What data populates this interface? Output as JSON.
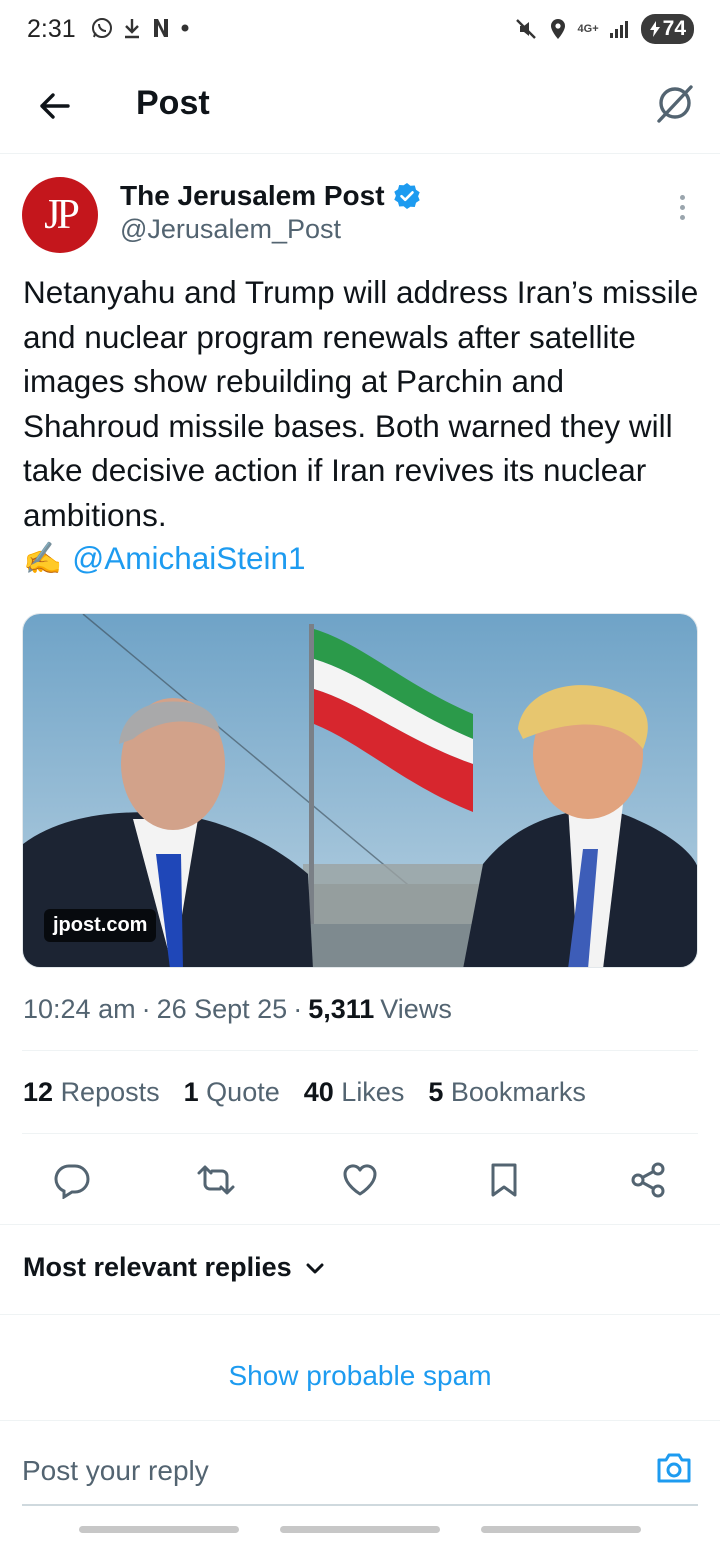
{
  "status_bar": {
    "time": "2:31",
    "left_icons": [
      "whatsapp-icon",
      "download-icon",
      "netflix-icon",
      "dot-icon"
    ],
    "network": "4G+",
    "battery": "74",
    "right_icons": [
      "mute-icon",
      "location-icon",
      "signal-icon",
      "battery-icon"
    ]
  },
  "header": {
    "title": "Post",
    "back_icon": "arrow-left-icon",
    "grok_icon": "grok-icon"
  },
  "author": {
    "avatar_text": "JP",
    "name": "The Jerusalem Post",
    "handle": "@Jerusalem_Post",
    "verified": true,
    "accent": "#1d9bf0",
    "avatar_color": "#c4161c"
  },
  "tweet": {
    "text": "Netanyahu and Trump will address Iran’s missile and nuclear program renewals after satellite images show rebuilding at Parchin and Shahroud missile bases. Both warned they will take decisive action if Iran revives its nuclear ambitions.",
    "mention_emoji": "✍️",
    "mention": "@AmichaiStein1",
    "media_source": "jpost.com"
  },
  "meta": {
    "time": "10:24 am",
    "sep1": "·",
    "date": "26 Sept 25",
    "sep2": "·",
    "views_count": "5,311",
    "views_label": "Views"
  },
  "stats": [
    {
      "count": "12",
      "label": "Reposts"
    },
    {
      "count": "1",
      "label": "Quote"
    },
    {
      "count": "40",
      "label": "Likes"
    },
    {
      "count": "5",
      "label": "Bookmarks"
    }
  ],
  "actions": [
    "reply-icon",
    "repost-icon",
    "like-icon",
    "bookmark-icon",
    "share-icon"
  ],
  "replies_filter": {
    "label": "Most relevant replies",
    "icon": "chevron-down-icon"
  },
  "spam_link": "Show probable spam",
  "reply_box": {
    "placeholder": "Post your reply",
    "icon": "camera-icon"
  }
}
